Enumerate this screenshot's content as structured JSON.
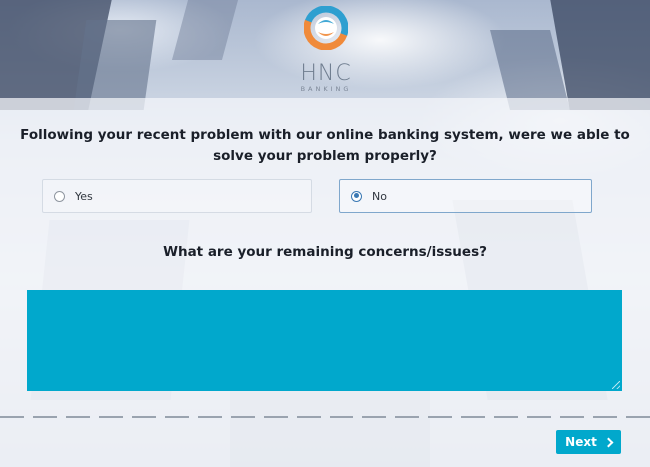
{
  "brand": {
    "name": "HNC",
    "subtitle": "BANKING"
  },
  "question1": {
    "text": "Following your recent problem with our online banking system, were we able to solve your problem properly?",
    "options": [
      {
        "label": "Yes",
        "selected": false
      },
      {
        "label": "No",
        "selected": true
      }
    ]
  },
  "question2": {
    "text": "What are your remaining concerns/issues?",
    "answer_value": ""
  },
  "progress": {
    "total_steps": 20
  },
  "navigation": {
    "next_label": "Next"
  },
  "colors": {
    "accent": "#01a8cc",
    "logo_orange": "#f08a3a",
    "logo_blue": "#2e9fd0",
    "selected_border": "#7fa7cc"
  }
}
